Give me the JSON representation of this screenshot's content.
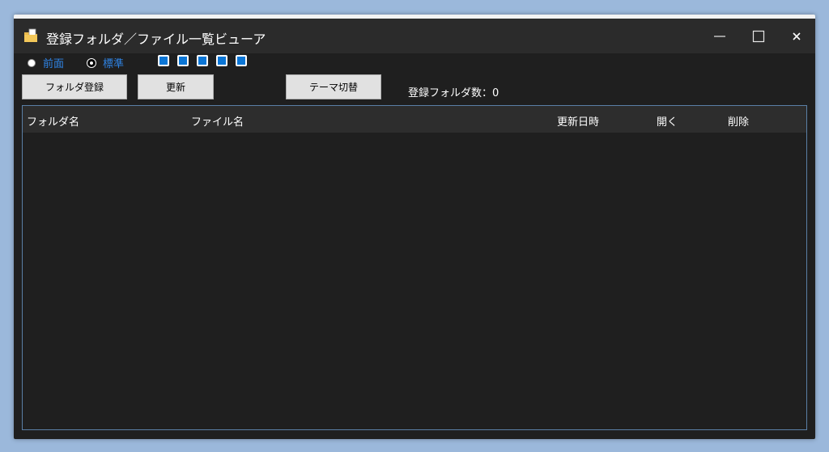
{
  "window": {
    "title": "登録フォルダ／ファイル一覧ビューア",
    "controls": {
      "minimize": "—",
      "maximize": "☐",
      "close": "✕"
    }
  },
  "options": {
    "radios": [
      {
        "label": "前面",
        "checked": false
      },
      {
        "label": "標準",
        "checked": true
      }
    ],
    "swatch_color": "#0b76d6",
    "swatch_count": 5
  },
  "toolbar": {
    "register_label": "フォルダ登録",
    "refresh_label": "更新",
    "theme_label": "テーマ切替",
    "count_text": "登録フォルダ数：0"
  },
  "list": {
    "columns": [
      "フォルダ名",
      "ファイル名",
      "更新日時",
      "開く",
      "削除"
    ],
    "rows": []
  },
  "colors": {
    "background": "#1f1f1f",
    "titlebar": "#2b2b2b",
    "accent": "#2f84e6",
    "list_border": "#5a7fa6"
  }
}
